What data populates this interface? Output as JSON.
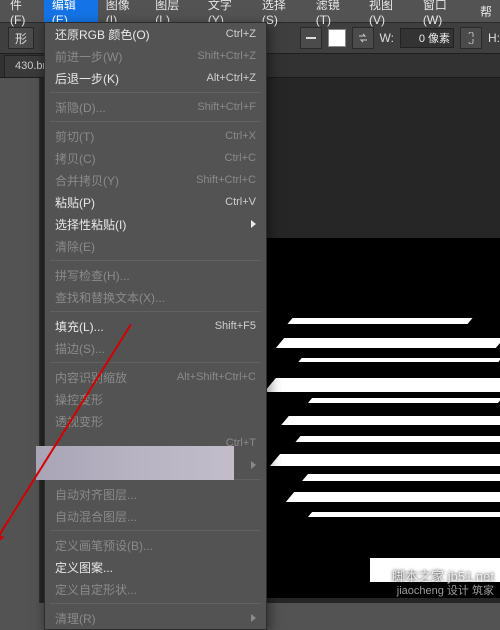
{
  "menubar": {
    "items": [
      "件(F)",
      "编辑(E)",
      "图像(I)",
      "图层(L)",
      "文字(Y)",
      "选择(S)",
      "滤镜(T)",
      "视图(V)",
      "窗口(W)",
      "帮"
    ]
  },
  "toolbar": {
    "shape_label": "形",
    "w_label": "W:",
    "w_value": "0 像素",
    "h_label": "H:"
  },
  "tab": {
    "name": "430.bn"
  },
  "menu": {
    "g1": [
      {
        "l": "还原RGB 颜色(O)",
        "s": "Ctrl+Z",
        "d": false
      },
      {
        "l": "前进一步(W)",
        "s": "Shift+Ctrl+Z",
        "d": true
      },
      {
        "l": "后退一步(K)",
        "s": "Alt+Ctrl+Z",
        "d": false
      }
    ],
    "g2": [
      {
        "l": "渐隐(D)...",
        "s": "Shift+Ctrl+F",
        "d": true
      }
    ],
    "g3": [
      {
        "l": "剪切(T)",
        "s": "Ctrl+X",
        "d": true
      },
      {
        "l": "拷贝(C)",
        "s": "Ctrl+C",
        "d": true
      },
      {
        "l": "合并拷贝(Y)",
        "s": "Shift+Ctrl+C",
        "d": true
      },
      {
        "l": "粘贴(P)",
        "s": "Ctrl+V",
        "d": false
      },
      {
        "l": "选择性粘贴(I)",
        "s": "",
        "d": false,
        "sub": true
      },
      {
        "l": "清除(E)",
        "s": "",
        "d": true
      }
    ],
    "g4": [
      {
        "l": "拼写检查(H)...",
        "s": "",
        "d": true
      },
      {
        "l": "查找和替换文本(X)...",
        "s": "",
        "d": true
      }
    ],
    "g5": [
      {
        "l": "填充(L)...",
        "s": "Shift+F5",
        "d": false
      },
      {
        "l": "描边(S)...",
        "s": "",
        "d": true
      }
    ],
    "g6": [
      {
        "l": "内容识别缩放",
        "s": "Alt+Shift+Ctrl+C",
        "d": true
      },
      {
        "l": "操控变形",
        "s": "",
        "d": true
      },
      {
        "l": "透视变形",
        "s": "",
        "d": true
      },
      {
        "l": "",
        "s": "Ctrl+T",
        "d": true
      },
      {
        "l": "",
        "s": "",
        "d": true,
        "sub": true
      }
    ],
    "g7": [
      {
        "l": "自动对齐图层...",
        "s": "",
        "d": true
      },
      {
        "l": "自动混合图层...",
        "s": "",
        "d": true
      }
    ],
    "g8": [
      {
        "l": "定义画笔预设(B)...",
        "s": "",
        "d": true
      },
      {
        "l": "定义图案...",
        "s": "",
        "d": false
      },
      {
        "l": "定义自定形状...",
        "s": "",
        "d": true
      }
    ],
    "g9": [
      {
        "l": "清理(R)",
        "s": "",
        "d": true,
        "sub": true
      }
    ]
  },
  "watermark": {
    "site": "脚本之家 jb51.net",
    "sub": "jiaocheng  设计  筑家"
  }
}
